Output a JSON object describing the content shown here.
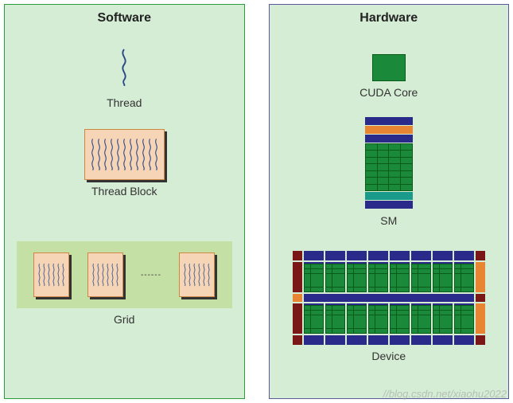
{
  "software": {
    "title": "Software",
    "thread_label": "Thread",
    "thread_block_label": "Thread Block",
    "grid_label": "Grid",
    "thread_block_threads": 11,
    "grid_block_threads": 6,
    "grid_visible_blocks": 3,
    "ellipsis": "------"
  },
  "hardware": {
    "title": "Hardware",
    "cuda_core_label": "CUDA Core",
    "sm_label": "SM",
    "device_label": "Device",
    "sm_core_grid": {
      "cols": 4,
      "rows": 7
    },
    "device_sm_count_per_row": 8,
    "device_sm_rows": 2
  },
  "icons": {
    "squiggle": "thread-squiggle-icon"
  },
  "watermark": "//blog.csdn.net/xiaohu2022"
}
